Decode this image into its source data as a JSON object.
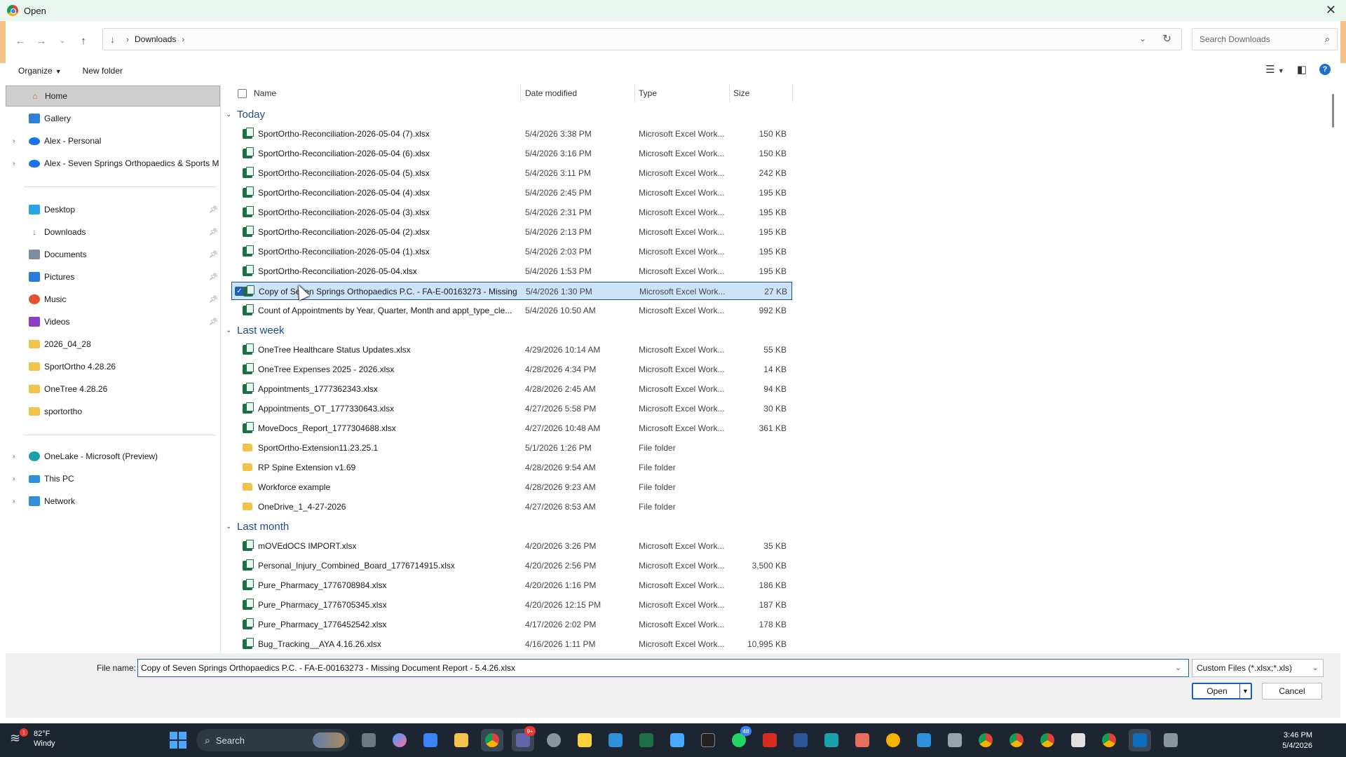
{
  "window": {
    "title": "Open"
  },
  "address": {
    "crumb": "Downloads"
  },
  "search": {
    "placeholder": "Search Downloads"
  },
  "toolbar": {
    "organize": "Organize",
    "new_folder": "New folder"
  },
  "sidebar": {
    "items": [
      {
        "label": "Home"
      },
      {
        "label": "Gallery"
      },
      {
        "label": "Alex - Personal"
      },
      {
        "label": "Alex - Seven Springs Orthopaedics & Sports Me"
      },
      {
        "label": "Desktop"
      },
      {
        "label": "Downloads"
      },
      {
        "label": "Documents"
      },
      {
        "label": "Pictures"
      },
      {
        "label": "Music"
      },
      {
        "label": "Videos"
      },
      {
        "label": "2026_04_28"
      },
      {
        "label": "SportOrtho 4.28.26"
      },
      {
        "label": "OneTree 4.28.26"
      },
      {
        "label": "sportortho"
      },
      {
        "label": "OneLake - Microsoft (Preview)"
      },
      {
        "label": "This PC"
      },
      {
        "label": "Network"
      }
    ]
  },
  "columns": {
    "name": "Name",
    "date": "Date modified",
    "type": "Type",
    "size": "Size"
  },
  "groups": [
    {
      "title": "Today",
      "files": [
        {
          "name": "SportOrtho-Reconciliation-2026-05-04 (7).xlsx",
          "date": "5/4/2026 3:38 PM",
          "type": "Microsoft Excel Work...",
          "size": "150 KB"
        },
        {
          "name": "SportOrtho-Reconciliation-2026-05-04 (6).xlsx",
          "date": "5/4/2026 3:16 PM",
          "type": "Microsoft Excel Work...",
          "size": "150 KB"
        },
        {
          "name": "SportOrtho-Reconciliation-2026-05-04 (5).xlsx",
          "date": "5/4/2026 3:11 PM",
          "type": "Microsoft Excel Work...",
          "size": "242 KB"
        },
        {
          "name": "SportOrtho-Reconciliation-2026-05-04 (4).xlsx",
          "date": "5/4/2026 2:45 PM",
          "type": "Microsoft Excel Work...",
          "size": "195 KB"
        },
        {
          "name": "SportOrtho-Reconciliation-2026-05-04 (3).xlsx",
          "date": "5/4/2026 2:31 PM",
          "type": "Microsoft Excel Work...",
          "size": "195 KB"
        },
        {
          "name": "SportOrtho-Reconciliation-2026-05-04 (2).xlsx",
          "date": "5/4/2026 2:13 PM",
          "type": "Microsoft Excel Work...",
          "size": "195 KB"
        },
        {
          "name": "SportOrtho-Reconciliation-2026-05-04 (1).xlsx",
          "date": "5/4/2026 2:03 PM",
          "type": "Microsoft Excel Work...",
          "size": "195 KB"
        },
        {
          "name": "SportOrtho-Reconciliation-2026-05-04.xlsx",
          "date": "5/4/2026 1:53 PM",
          "type": "Microsoft Excel Work...",
          "size": "195 KB"
        },
        {
          "name": "Copy of Seven Springs Orthopaedics P.C. - FA-E-00163273 - Missing...",
          "date": "5/4/2026 1:30 PM",
          "type": "Microsoft Excel Work...",
          "size": "27 KB",
          "selected": true
        },
        {
          "name": "Count of Appointments by Year, Quarter, Month and appt_type_cle...",
          "date": "5/4/2026 10:50 AM",
          "type": "Microsoft Excel Work...",
          "size": "992 KB"
        }
      ]
    },
    {
      "title": "Last week",
      "files": [
        {
          "name": "OneTree Healthcare Status Updates.xlsx",
          "date": "4/29/2026 10:14 AM",
          "type": "Microsoft Excel Work...",
          "size": "55 KB"
        },
        {
          "name": "OneTree Expenses 2025 - 2026.xlsx",
          "date": "4/28/2026 4:34 PM",
          "type": "Microsoft Excel Work...",
          "size": "14 KB"
        },
        {
          "name": "Appointments_1777362343.xlsx",
          "date": "4/28/2026 2:45 AM",
          "type": "Microsoft Excel Work...",
          "size": "94 KB"
        },
        {
          "name": "Appointments_OT_1777330643.xlsx",
          "date": "4/27/2026 5:58 PM",
          "type": "Microsoft Excel Work...",
          "size": "30 KB"
        },
        {
          "name": "MoveDocs_Report_1777304688.xlsx",
          "date": "4/27/2026 10:48 AM",
          "type": "Microsoft Excel Work...",
          "size": "361 KB"
        },
        {
          "name": "SportOrtho-Extension11.23.25.1",
          "date": "5/1/2026 1:26 PM",
          "type": "File folder",
          "size": "",
          "folder": true
        },
        {
          "name": "RP Spine Extension v1.69",
          "date": "4/28/2026 9:54 AM",
          "type": "File folder",
          "size": "",
          "folder": true
        },
        {
          "name": "Workforce example",
          "date": "4/28/2026 9:23 AM",
          "type": "File folder",
          "size": "",
          "folder": true
        },
        {
          "name": "OneDrive_1_4-27-2026",
          "date": "4/27/2026 8:53 AM",
          "type": "File folder",
          "size": "",
          "folder": true
        }
      ]
    },
    {
      "title": "Last month",
      "files": [
        {
          "name": "mOVEdOCS IMPORT.xlsx",
          "date": "4/20/2026 3:26 PM",
          "type": "Microsoft Excel Work...",
          "size": "35 KB"
        },
        {
          "name": "Personal_Injury_Combined_Board_1776714915.xlsx",
          "date": "4/20/2026 2:56 PM",
          "type": "Microsoft Excel Work...",
          "size": "3,500 KB"
        },
        {
          "name": "Pure_Pharmacy_1776708984.xlsx",
          "date": "4/20/2026 1:16 PM",
          "type": "Microsoft Excel Work...",
          "size": "186 KB"
        },
        {
          "name": "Pure_Pharmacy_1776705345.xlsx",
          "date": "4/20/2026 12:15 PM",
          "type": "Microsoft Excel Work...",
          "size": "187 KB"
        },
        {
          "name": "Pure_Pharmacy_1776452542.xlsx",
          "date": "4/17/2026 2:02 PM",
          "type": "Microsoft Excel Work...",
          "size": "178 KB"
        },
        {
          "name": "Bug_Tracking__AYA 4.16.26.xlsx",
          "date": "4/16/2026 1:11 PM",
          "type": "Microsoft Excel Work...",
          "size": "10,995 KB"
        }
      ]
    }
  ],
  "footer": {
    "file_name_label": "File name:",
    "file_name_value": "Copy of Seven Springs Orthopaedics P.C. - FA-E-00163273 - Missing Document Report - 5.4.26.xlsx",
    "filter": "Custom Files (*.xlsx;*.xls)",
    "open": "Open",
    "cancel": "Cancel"
  },
  "taskbar": {
    "weather_temp": "82°F",
    "weather_desc": "Windy",
    "weather_badge": "1",
    "search": "Search",
    "time": "3:46 PM",
    "date": "5/4/2026",
    "badge_teams": "9+",
    "badge_whatsapp": "48"
  }
}
